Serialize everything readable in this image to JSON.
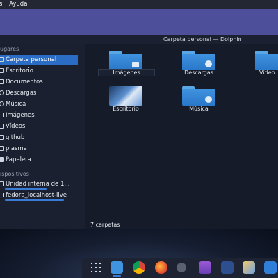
{
  "menu": {
    "items": [
      "s",
      "Ayuda"
    ]
  },
  "window": {
    "title": "Carpeta personal — Dolphin"
  },
  "sidebar": {
    "places_heading": "ugares",
    "places": [
      {
        "label": "Carpeta personal",
        "icon": "home-icon",
        "active": true
      },
      {
        "label": "Escritorio",
        "icon": "desktop-icon"
      },
      {
        "label": "Documentos",
        "icon": "documents-icon"
      },
      {
        "label": "Descargas",
        "icon": "downloads-icon"
      },
      {
        "label": "Música",
        "icon": "music-icon"
      },
      {
        "label": "Imágenes",
        "icon": "images-icon"
      },
      {
        "label": "Vídeos",
        "icon": "videos-icon"
      },
      {
        "label": "github",
        "icon": "folder-icon"
      },
      {
        "label": "plasma",
        "icon": "folder-icon"
      },
      {
        "label": "Papelera",
        "icon": "trash-icon"
      }
    ],
    "devices_heading": "ispositivos",
    "devices": [
      {
        "label": "Unidad interna de 1...",
        "icon": "drive-icon"
      },
      {
        "label": "fedora_localhost-live",
        "icon": "drive-icon"
      }
    ]
  },
  "files": [
    {
      "label": "Imágenes",
      "type": "images-folder",
      "selected": true
    },
    {
      "label": "Descargas",
      "type": "downloads-folder"
    },
    {
      "label": "Vídeo",
      "type": "videos-folder"
    },
    {
      "label": "Escritorio",
      "type": "desktop-folder"
    },
    {
      "label": "Música",
      "type": "music-folder"
    }
  ],
  "status": {
    "text": "7 carpetas"
  },
  "dock": {
    "items": [
      "app-launcher-icon",
      "file-manager-icon",
      "chrome-icon",
      "firefox-icon",
      "settings-icon",
      "store-icon",
      "terminal-icon",
      "image-viewer-icon",
      "app-icon"
    ],
    "colors": {
      "accent": "#3a7bd5",
      "titlebar": "#4e4f9a",
      "active": "#2b6cc4"
    }
  }
}
